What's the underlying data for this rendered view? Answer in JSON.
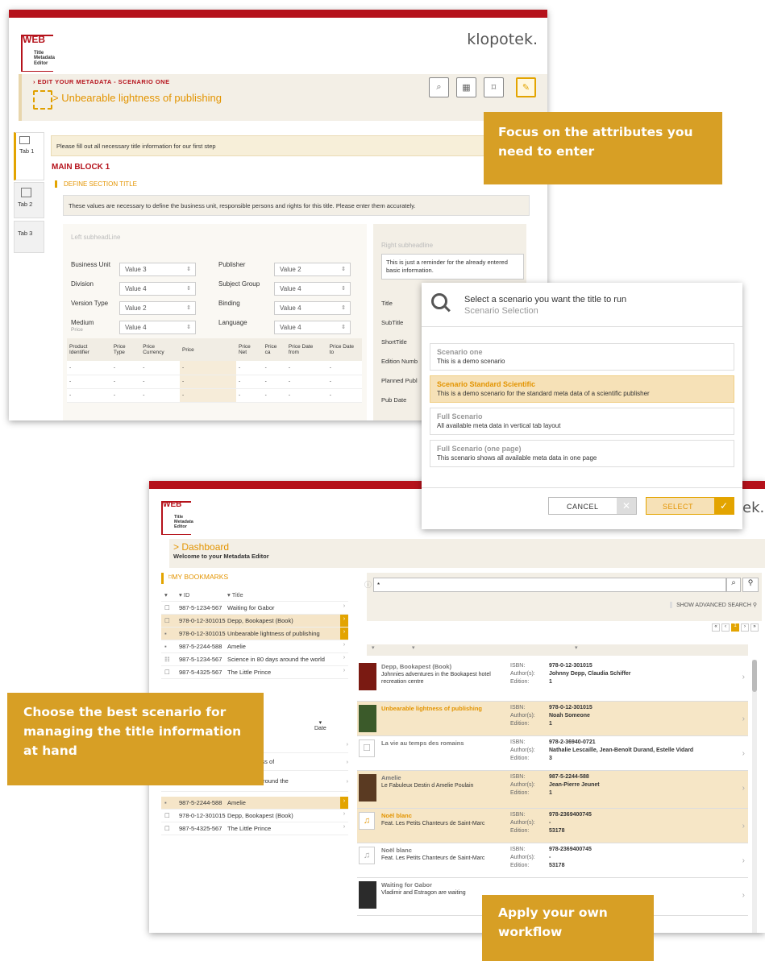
{
  "editor": {
    "logo": {
      "mark": "WEB",
      "line1": "Title Metadata",
      "line2": "Editor"
    },
    "brand": "klopotek.",
    "breadcrumb": "EDIT YOUR METADATA - SCENARIO ONE",
    "title": "Unbearable lightness of publishing",
    "title_prefix": ">",
    "tabs": [
      "Tab 1",
      "Tab 2",
      "Tab 3"
    ],
    "info": "Please fill out all necessary title information for our first step",
    "main_block": "MAIN BLOCK 1",
    "section_title": "DEFINE SECTION TITLE",
    "section_desc": "These values are necessary to define the business unit, responsible persons and rights for this title. Please enter them accurately.",
    "left_sub": "Left subheadLine",
    "right_sub": "Right subheadline",
    "reminder": "This is just a reminder for the already entered basic information.",
    "fields_left": [
      {
        "label": "Business Unit",
        "value": "Value 3"
      },
      {
        "label": "Division",
        "value": "Value 4"
      },
      {
        "label": "Version Type",
        "value": "Value 2"
      },
      {
        "label": "Medium",
        "value": "Value 4"
      }
    ],
    "fields_mid": [
      {
        "label": "Publisher",
        "value": "Value 2"
      },
      {
        "label": "Subject Group",
        "value": "Value 4"
      },
      {
        "label": "Binding",
        "value": "Value 4"
      },
      {
        "label": "Language",
        "value": "Value 4"
      }
    ],
    "right_labels": [
      "Title",
      "SubTitle",
      "ShortTitle",
      "Edition Numb",
      "Planned Publ",
      "Pub Date"
    ],
    "price_label": "Price",
    "price_cols": [
      "Product Identifier",
      "Price Type",
      "Price Currency",
      "Price",
      "Price Net",
      "Price ca",
      "Price Date from",
      "Price Date to"
    ],
    "dash": "-"
  },
  "dialog": {
    "title": "Select a scenario you want the title to run",
    "subtitle": "Scenario Selection",
    "scenarios": [
      {
        "name": "Scenario one",
        "desc": "This is a demo scenario"
      },
      {
        "name": "Scenario Standard Scientific",
        "desc": "This is a demo scenario for the standard meta data of a scientific publisher"
      },
      {
        "name": "Full Scenario",
        "desc": "All available meta data in vertical tab layout"
      },
      {
        "name": "Full Scenario (one page)",
        "desc": "This scenario shows all available meta data in one page"
      }
    ],
    "cancel": "CANCEL",
    "select": "SELECT"
  },
  "dashboard": {
    "logo": {
      "mark": "WEB",
      "line1": "Title Metadata",
      "line2": "Editor"
    },
    "brand_tail": "ek.",
    "title": "> Dashboard",
    "subtitle": "Welcome to your Metadata Editor",
    "bookmarks_title": "MY BOOKMARKS",
    "col_id": "ID",
    "col_title": "Title",
    "col_date": "Date",
    "bookmarks": [
      {
        "id": "987-5-1234-567",
        "title": "Waiting for Gabor"
      },
      {
        "id": "978-0-12-301015",
        "title": "Depp, Bookapest (Book)"
      },
      {
        "id": "978-0-12-301015",
        "title": "Unbearable lightness of publishing"
      },
      {
        "id": "987-5-2244-588",
        "title": "Amelie"
      },
      {
        "id": "987-5-1234-567",
        "title": "Science in 80 days around the world"
      },
      {
        "id": "987-5-4325-567",
        "title": "The Little Prince"
      }
    ],
    "recent_fragments": [
      "bor",
      "ightness of",
      "days around the"
    ],
    "recent": [
      {
        "id": "987-5-2244-588",
        "title": "Amelie"
      },
      {
        "id": "978-0-12-301015",
        "title": "Depp, Bookapest (Book)"
      },
      {
        "id": "987-5-4325-567",
        "title": "The Little Prince"
      }
    ],
    "search_value": "*",
    "advanced": "SHOW ADVANCED SEARCH",
    "page": "1",
    "meta_labels": [
      "ISBN:",
      "Author(s):",
      "Edition:"
    ],
    "results": [
      {
        "title": "Depp, Bookapest (Book)",
        "sub": "Johnnies adventures in the Bookapest hotel recreation centre",
        "isbn": "978-0-12-301015",
        "author": "Johnny Depp, Claudia Schiffer",
        "edition": "1"
      },
      {
        "title": "Unbearable lightness of publishing",
        "sub": "",
        "isbn": "978-0-12-301015",
        "author": "Noah Someone",
        "edition": "1"
      },
      {
        "title": "La vie au temps des romains",
        "sub": "",
        "isbn": "978-2-36940-0721",
        "author": "Nathalie Lescaille, Jean-Benoît Durand, Estelle Vidard",
        "edition": "3"
      },
      {
        "title": "Amelie",
        "sub": "Le Fabuleux Destin d Amelie Poulain",
        "isbn": "987-5-2244-588",
        "author": "Jean-Pierre Jeunet",
        "edition": "1"
      },
      {
        "title": "Noël blanc",
        "sub": "Feat. Les Petits Chanteurs de Saint-Marc",
        "isbn": "978-2369400745",
        "author": "-",
        "edition": "53178"
      },
      {
        "title": "Noël blanc",
        "sub": "Feat. Les Petits Chanteurs de Saint-Marc",
        "isbn": "978-2369400745",
        "author": "-",
        "edition": "53178"
      },
      {
        "title": "Waiting for Gabor",
        "sub": "Vladimir and Estragon are waiting",
        "isbn": "",
        "author": "",
        "edition": ""
      }
    ]
  },
  "callouts": {
    "focus": "Focus on the attributes you need to enter",
    "choose": "Choose the best scenario for managing the title information at hand",
    "apply": "Apply your own workflow"
  }
}
